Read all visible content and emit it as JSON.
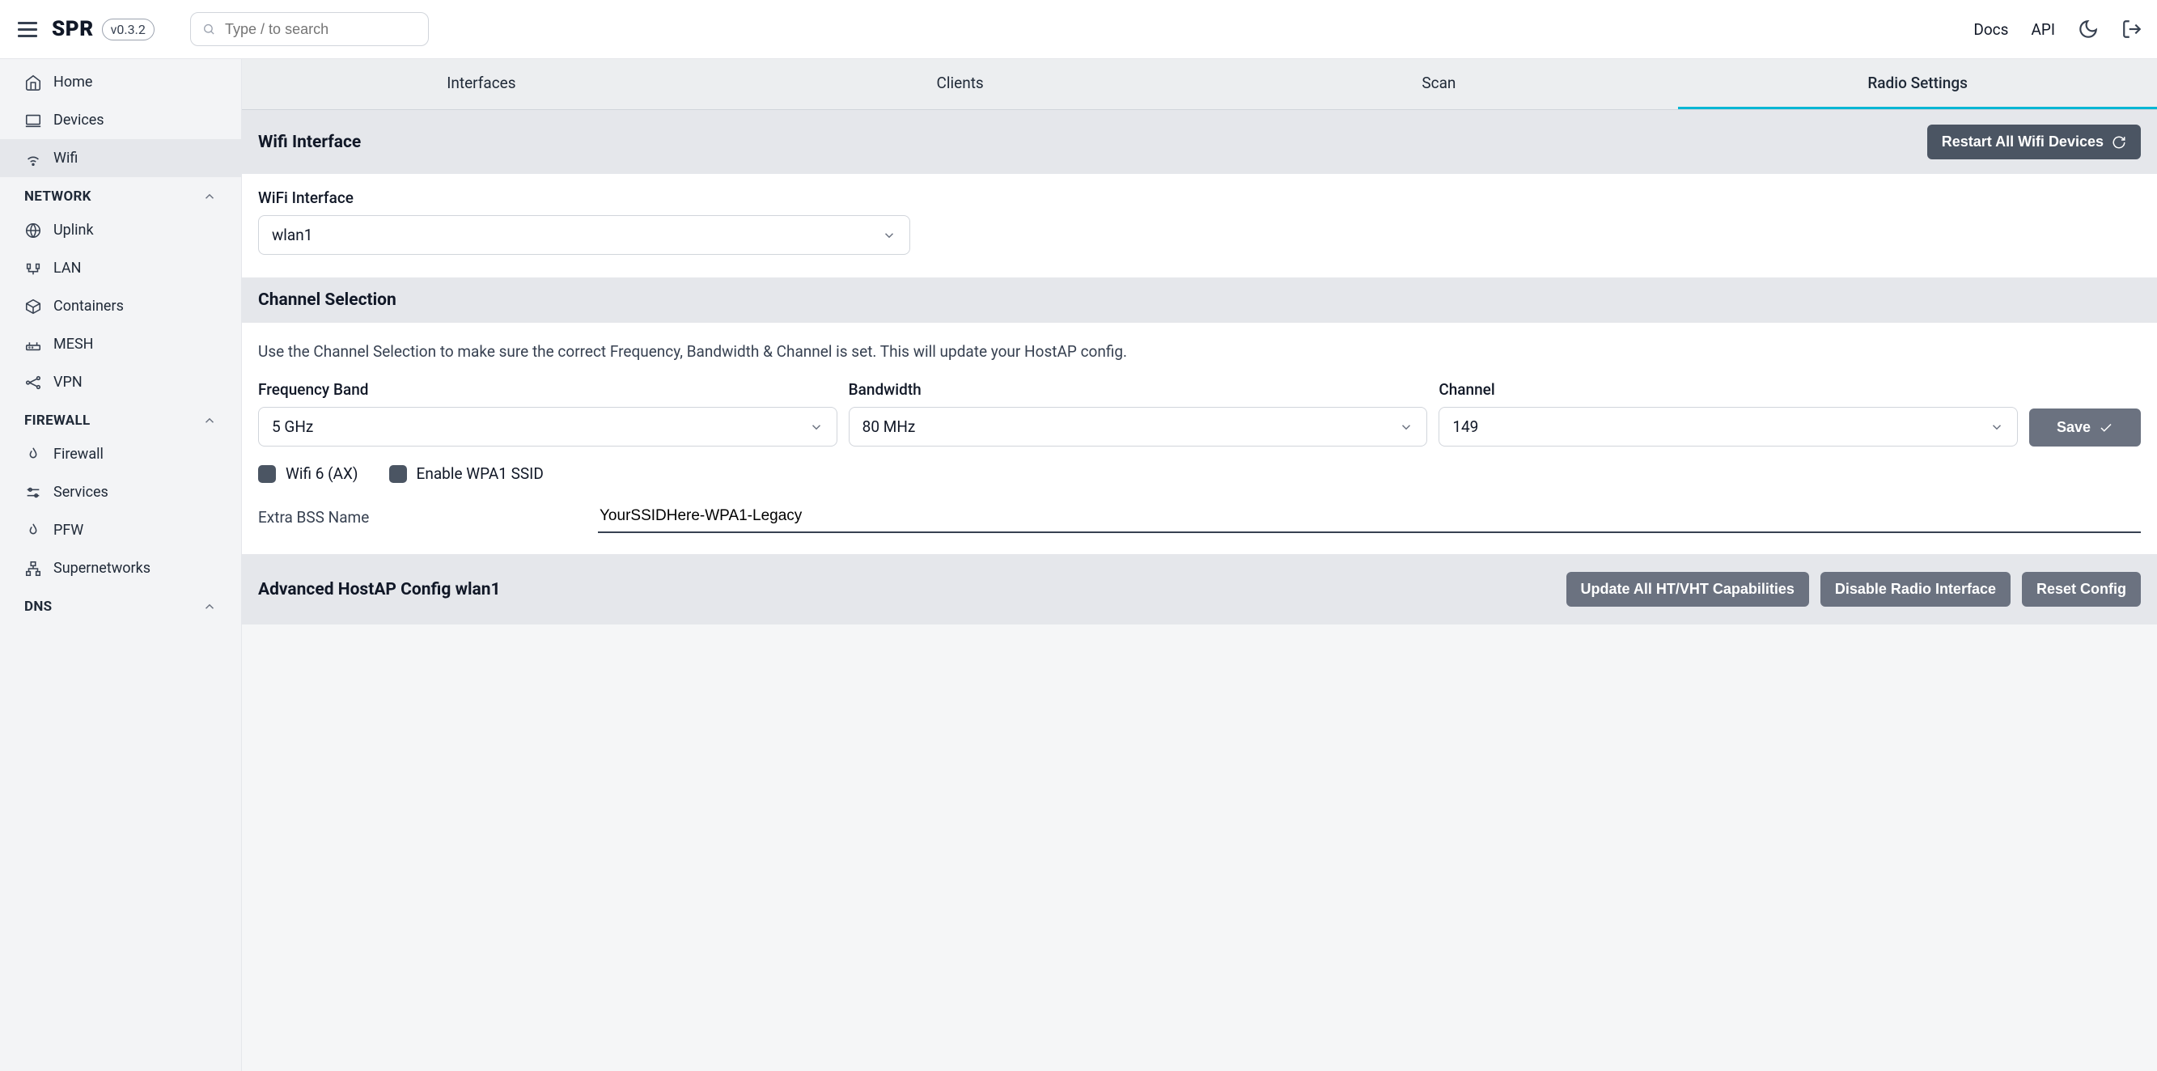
{
  "brand": "SPR",
  "version": "v0.3.2",
  "search_placeholder": "Type / to search",
  "top_links": {
    "docs": "Docs",
    "api": "API"
  },
  "sidebar": {
    "home": "Home",
    "devices": "Devices",
    "wifi": "Wifi",
    "network_header": "NETWORK",
    "uplink": "Uplink",
    "lan": "LAN",
    "containers": "Containers",
    "mesh": "MESH",
    "vpn": "VPN",
    "firewall_header": "FIREWALL",
    "firewall": "Firewall",
    "services": "Services",
    "pfw": "PFW",
    "supernetworks": "Supernetworks",
    "dns_header": "DNS"
  },
  "tabs": {
    "interfaces": "Interfaces",
    "clients": "Clients",
    "scan": "Scan",
    "radio": "Radio Settings"
  },
  "wifi_interface": {
    "title": "Wifi Interface",
    "restart_btn": "Restart All Wifi Devices",
    "label": "WiFi Interface",
    "value": "wlan1"
  },
  "channel_selection": {
    "title": "Channel Selection",
    "hint": "Use the Channel Selection to make sure the correct Frequency, Bandwidth & Channel is set. This will update your HostAP config.",
    "freq_label": "Frequency Band",
    "freq_value": "5 GHz",
    "bw_label": "Bandwidth",
    "bw_value": "80 MHz",
    "channel_label": "Channel",
    "channel_value": "149",
    "save_btn": "Save",
    "wifi6_label": "Wifi 6 (AX)",
    "wpa1_label": "Enable WPA1 SSID",
    "extra_bss_label": "Extra BSS Name",
    "extra_bss_value": "YourSSIDHere-WPA1-Legacy"
  },
  "advanced": {
    "title": "Advanced HostAP Config wlan1",
    "update_btn": "Update All HT/VHT Capabilities",
    "disable_btn": "Disable Radio Interface",
    "reset_btn": "Reset Config"
  }
}
